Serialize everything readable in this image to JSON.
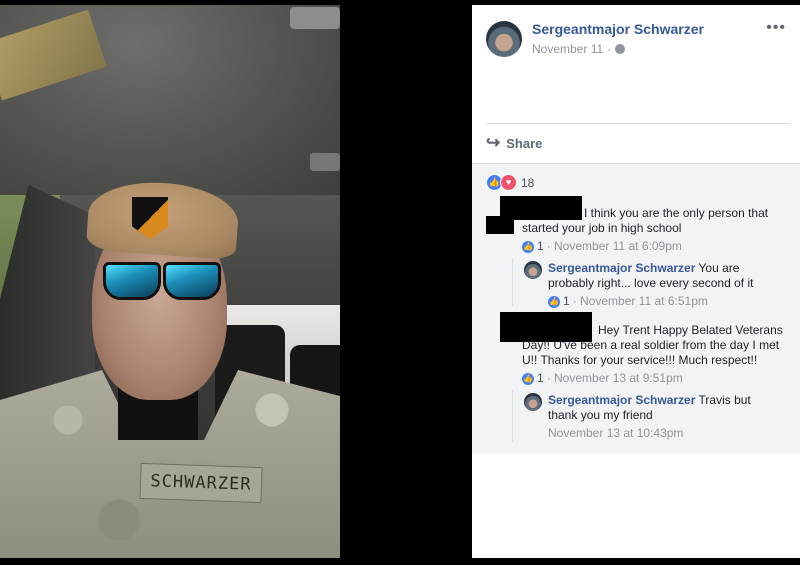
{
  "post": {
    "author": "Sergeantmajor Schwarzer",
    "date": "November 11",
    "separator": "·",
    "more": "•••",
    "share_label": "Share",
    "reaction_count": "18",
    "photo_nametape": "SCHWARZER"
  },
  "comments": [
    {
      "text": "I think you are the only person that started your job in high school",
      "likes": "1",
      "timestamp": "· November 11 at 6:09pm"
    },
    {
      "author": "Sergeantmajor Schwarzer",
      "text": " You are probably right... love every second of it",
      "likes": "1",
      "timestamp": "· November 11 at 6:51pm"
    },
    {
      "text": "Hey Trent Happy Belated Veterans Day!! U've been a real soldier from the day I met U!! Thanks for your service!!! Much respect!!",
      "likes": "1",
      "timestamp": "· November 13 at 9:51pm"
    },
    {
      "author": "Sergeantmajor Schwarzer",
      "text": " Travis but thank you my friend",
      "timestamp": "November 13 at 10:43pm"
    }
  ],
  "colors": {
    "link": "#365899",
    "meta": "#90949c",
    "like": "#4080ff",
    "love": "#f25268"
  }
}
